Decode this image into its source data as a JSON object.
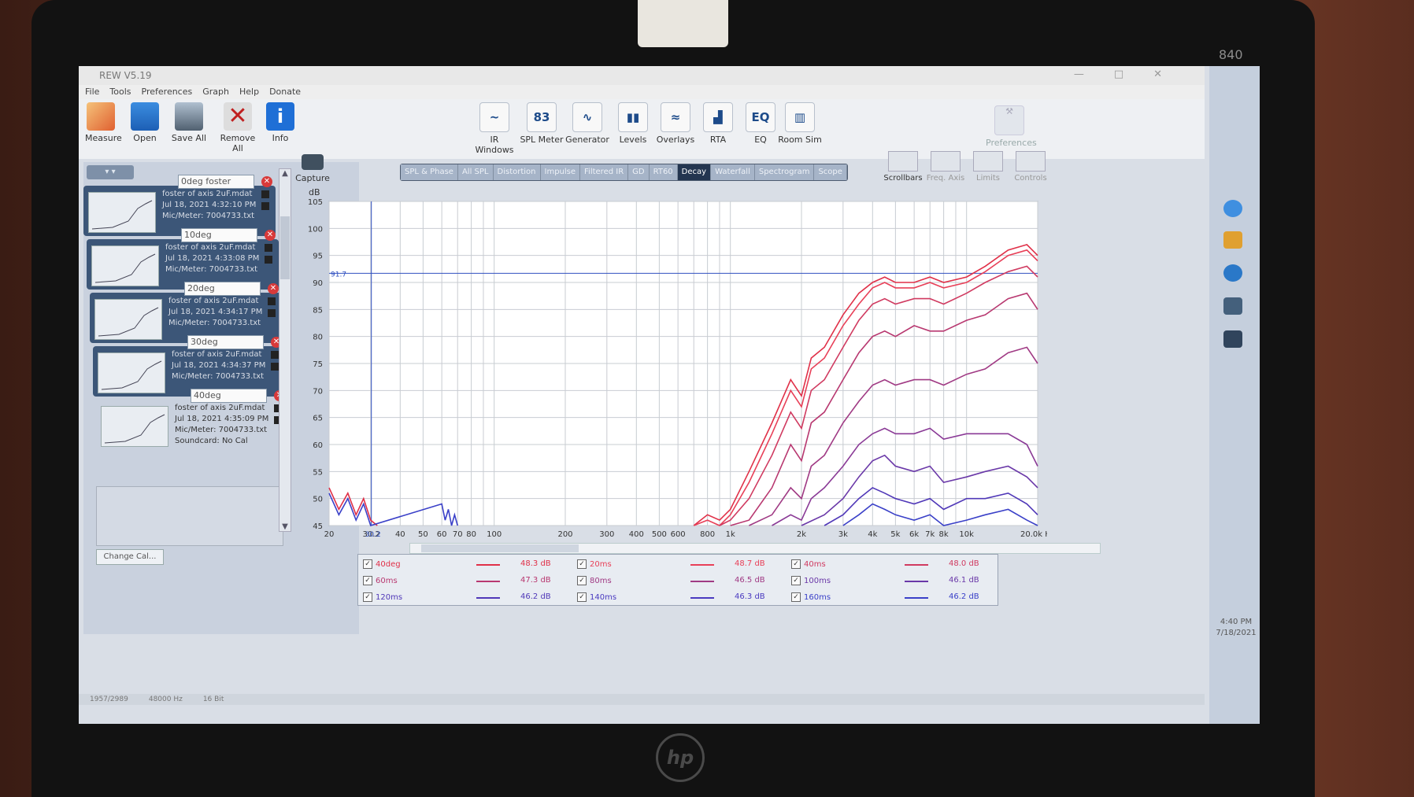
{
  "window": {
    "title": "REW V5.19",
    "menu": [
      "File",
      "Tools",
      "Preferences",
      "Graph",
      "Help",
      "Donate"
    ]
  },
  "toolbar_left": [
    {
      "label": "Measure",
      "icon": "measure-icon"
    },
    {
      "label": "Open",
      "icon": "folder-icon"
    },
    {
      "label": "Save All",
      "icon": "save-icon"
    },
    {
      "label": "Remove All",
      "icon": "remove-icon"
    },
    {
      "label": "Info",
      "icon": "info-icon"
    }
  ],
  "toolbar_center": [
    {
      "label": "IR Windows",
      "glyph": "~"
    },
    {
      "label": "SPL Meter",
      "glyph": "83"
    },
    {
      "label": "Generator",
      "glyph": "∿"
    },
    {
      "label": "Levels",
      "glyph": "▮▮"
    },
    {
      "label": "Overlays",
      "glyph": "≈"
    },
    {
      "label": "RTA",
      "glyph": "▟"
    },
    {
      "label": "EQ",
      "glyph": "EQ"
    },
    {
      "label": "Room Sim",
      "glyph": "▥"
    }
  ],
  "preferences_label": "Preferences",
  "measurements": [
    {
      "name": "0deg foster",
      "line1": "foster of axis 2uF.mdat",
      "line2": "Jul 18, 2021 4:32:10 PM",
      "line3": "Mic/Meter: 7004733.txt"
    },
    {
      "name": "10deg",
      "line1": "foster of axis 2uF.mdat",
      "line2": "Jul 18, 2021 4:33:08 PM",
      "line3": "Mic/Meter: 7004733.txt"
    },
    {
      "name": "20deg",
      "line1": "foster of axis 2uF.mdat",
      "line2": "Jul 18, 2021 4:34:17 PM",
      "line3": "Mic/Meter: 7004733.txt"
    },
    {
      "name": "30deg",
      "line1": "foster of axis 2uF.mdat",
      "line2": "Jul 18, 2021 4:34:37 PM",
      "line3": "Mic/Meter: 7004733.txt"
    },
    {
      "name": "40deg",
      "line1": "foster of axis 2uF.mdat",
      "line2": "Jul 18, 2021 4:35:09 PM",
      "line3": "Mic/Meter: 7004733.txt",
      "line4": "Soundcard: No Cal"
    }
  ],
  "change_cal_label": "Change Cal...",
  "capture_label": "Capture",
  "tabs": [
    "SPL & Phase",
    "All SPL",
    "Distortion",
    "Impulse",
    "Filtered IR",
    "GD",
    "RT60",
    "Decay",
    "Waterfall",
    "Spectrogram",
    "Scope"
  ],
  "active_tab": "Decay",
  "right_tools": [
    {
      "label": "Scrollbars",
      "dim": false
    },
    {
      "label": "Freq. Axis",
      "dim": true
    },
    {
      "label": "Limits",
      "dim": true
    },
    {
      "label": "Controls",
      "dim": true
    }
  ],
  "chart_data": {
    "type": "line",
    "ylabel": "dB",
    "xlabel": "Hz",
    "x_scale": "log",
    "xlim": [
      20,
      20000
    ],
    "ylim": [
      45,
      105
    ],
    "y_ticks": [
      45,
      50,
      55,
      60,
      65,
      70,
      75,
      80,
      85,
      90,
      95,
      100,
      105
    ],
    "x_tick_labels": [
      "20",
      "30.2",
      "40",
      "50",
      "60",
      "70",
      "80",
      "100",
      "200",
      "300",
      "400",
      "500",
      "600",
      "800",
      "1k",
      "2k",
      "3k",
      "4k",
      "5k",
      "6k",
      "7k",
      "8k",
      "10k",
      "20.0k Hz"
    ],
    "x_ticks": [
      20,
      30.2,
      40,
      50,
      60,
      70,
      80,
      100,
      200,
      300,
      400,
      500,
      600,
      800,
      1000,
      2000,
      3000,
      4000,
      5000,
      6000,
      7000,
      8000,
      10000,
      20000
    ],
    "cursor": {
      "x": 30.2,
      "y": 91.7,
      "y_label": "91.7",
      "x_label": "30.2"
    },
    "grid": true,
    "series": [
      {
        "name": "40deg",
        "color": "#e03048",
        "x": [
          20,
          22,
          24,
          26,
          28,
          30,
          32,
          700,
          800,
          900,
          1000,
          1200,
          1500,
          1800,
          2000,
          2200,
          2500,
          3000,
          3500,
          4000,
          4500,
          5000,
          6000,
          7000,
          8000,
          10000,
          12000,
          15000,
          18000,
          20000
        ],
        "y": [
          52,
          48,
          51,
          47,
          50,
          46,
          45,
          45,
          47,
          46,
          48,
          55,
          64,
          72,
          69,
          76,
          78,
          84,
          88,
          90,
          91,
          90,
          90,
          91,
          90,
          91,
          93,
          96,
          97,
          95
        ]
      },
      {
        "name": "20ms",
        "color": "#e84058",
        "x": [
          700,
          800,
          900,
          1000,
          1200,
          1500,
          1800,
          2000,
          2200,
          2500,
          3000,
          3500,
          4000,
          4500,
          5000,
          6000,
          7000,
          8000,
          10000,
          12000,
          15000,
          18000,
          20000
        ],
        "y": [
          45,
          46,
          45,
          47,
          53,
          62,
          70,
          67,
          74,
          76,
          82,
          86,
          89,
          90,
          89,
          89,
          90,
          89,
          90,
          92,
          95,
          96,
          94
        ]
      },
      {
        "name": "40ms",
        "color": "#d03a60",
        "x": [
          900,
          1000,
          1200,
          1500,
          1800,
          2000,
          2200,
          2500,
          3000,
          3500,
          4000,
          4500,
          5000,
          6000,
          7000,
          8000,
          10000,
          12000,
          15000,
          18000,
          20000
        ],
        "y": [
          45,
          46,
          50,
          58,
          66,
          63,
          70,
          72,
          78,
          83,
          86,
          87,
          86,
          87,
          87,
          86,
          88,
          90,
          92,
          93,
          91
        ]
      },
      {
        "name": "60ms",
        "color": "#b83870",
        "x": [
          1000,
          1200,
          1500,
          1800,
          2000,
          2200,
          2500,
          3000,
          3500,
          4000,
          4500,
          5000,
          6000,
          7000,
          8000,
          10000,
          12000,
          15000,
          18000,
          20000
        ],
        "y": [
          45,
          46,
          52,
          60,
          57,
          64,
          66,
          72,
          77,
          80,
          81,
          80,
          82,
          81,
          81,
          83,
          84,
          87,
          88,
          85
        ]
      },
      {
        "name": "80ms",
        "color": "#a03a84",
        "x": [
          1200,
          1500,
          1800,
          2000,
          2200,
          2500,
          3000,
          3500,
          4000,
          4500,
          5000,
          6000,
          7000,
          8000,
          10000,
          12000,
          15000,
          18000,
          20000
        ],
        "y": [
          45,
          47,
          52,
          50,
          56,
          58,
          64,
          68,
          71,
          72,
          71,
          72,
          72,
          71,
          73,
          74,
          77,
          78,
          75
        ]
      },
      {
        "name": "100ms",
        "color": "#8a3a96",
        "x": [
          1500,
          1800,
          2000,
          2200,
          2500,
          3000,
          3500,
          4000,
          4500,
          5000,
          6000,
          7000,
          8000,
          10000,
          12000,
          15000,
          18000,
          20000
        ],
        "y": [
          45,
          47,
          46,
          50,
          52,
          56,
          60,
          62,
          63,
          62,
          62,
          63,
          61,
          62,
          62,
          62,
          60,
          56
        ]
      },
      {
        "name": "120ms",
        "color": "#6a38a8",
        "x": [
          2000,
          2500,
          3000,
          3500,
          4000,
          4500,
          5000,
          6000,
          7000,
          8000,
          10000,
          12000,
          15000,
          18000,
          20000
        ],
        "y": [
          45,
          47,
          50,
          54,
          57,
          58,
          56,
          55,
          56,
          53,
          54,
          55,
          56,
          54,
          52
        ]
      },
      {
        "name": "140ms",
        "color": "#5038b8",
        "x": [
          2500,
          3000,
          3500,
          4000,
          4500,
          5000,
          6000,
          7000,
          8000,
          10000,
          12000,
          15000,
          18000,
          20000
        ],
        "y": [
          45,
          47,
          50,
          52,
          51,
          50,
          49,
          50,
          48,
          50,
          50,
          51,
          49,
          47
        ]
      },
      {
        "name": "160ms",
        "color": "#3a40c8",
        "x": [
          20,
          22,
          24,
          26,
          28,
          30,
          60,
          62,
          64,
          66,
          68,
          70,
          3000,
          3500,
          4000,
          4500,
          5000,
          6000,
          7000,
          8000,
          10000,
          12000,
          15000,
          18000,
          20000
        ],
        "y": [
          51,
          47,
          50,
          46,
          49,
          45,
          49,
          46,
          48,
          45,
          47,
          45,
          45,
          47,
          49,
          48,
          47,
          46,
          47,
          45,
          46,
          47,
          48,
          46,
          45
        ]
      }
    ]
  },
  "legend": [
    {
      "name": "40deg",
      "db": "48.3 dB",
      "color": "#e03048"
    },
    {
      "name": "20ms",
      "db": "48.7 dB",
      "color": "#e84058"
    },
    {
      "name": "40ms",
      "db": "48.0 dB",
      "color": "#d03a60"
    },
    {
      "name": "60ms",
      "db": "47.3 dB",
      "color": "#b83870"
    },
    {
      "name": "80ms",
      "db": "46.5 dB",
      "color": "#a03a84"
    },
    {
      "name": "100ms",
      "db": "46.1 dB",
      "color": "#6a38a8"
    },
    {
      "name": "120ms",
      "db": "46.2 dB",
      "color": "#5038b8"
    },
    {
      "name": "140ms",
      "db": "46.3 dB",
      "color": "#4a3ac0"
    },
    {
      "name": "160ms",
      "db": "46.2 dB",
      "color": "#3a40c8"
    }
  ],
  "statusbar": [
    "1957/2989",
    "48000 Hz",
    "16 Bit"
  ],
  "tray": {
    "time": "4:40 PM",
    "date": "7/18/2021"
  },
  "laptop_model": "840"
}
